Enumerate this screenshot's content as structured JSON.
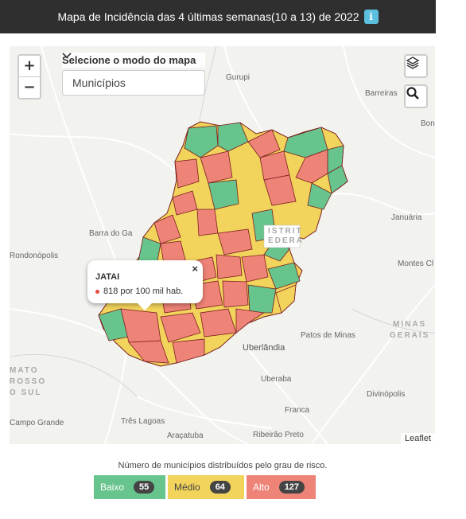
{
  "header": {
    "title": "Mapa de Incidência das 4 últimas semanas(10 a 13) de 2022",
    "info_icon": "info-icon"
  },
  "map_controls": {
    "zoom_in": "+",
    "zoom_out": "−",
    "mode_label": "Selecione o modo do mapa",
    "mode_selected": "Municípios",
    "layers_icon": "layers-icon",
    "search_icon": "search-icon"
  },
  "map_labels": {
    "gurupi": "Gurupi",
    "barreiras": "Barreiras",
    "bon": "Bon",
    "ob": "(",
    "barra": "Barra do Ga",
    "distrito1": "ISTRIT",
    "distrito2": "EDERA",
    "rondonopolis": "Rondonópolis",
    "montes": "Montes Cl",
    "januaria": "Januária",
    "patos": "Patos de Minas",
    "minas1": "MINAS",
    "minas2": "GERAIS",
    "uberlandia": "Uberlândia",
    "uberaba": "Uberaba",
    "mato1": "MATO",
    "mato2": "ROSSO",
    "mato3": "O SUL",
    "divinopolis": "Divinópolis",
    "franca": "Franca",
    "campo": "Campo Grande",
    "tres": "Três Lagoas",
    "aracatuba": "Araçatuba",
    "ribeirao": "Ribeirão Preto",
    "attribution": "Leaflet"
  },
  "popup": {
    "name": "JATAI",
    "value": "818 por 100 mil hab.",
    "close": "×"
  },
  "legend": {
    "title": "Número de municípios distribuídos pelo grau de risco.",
    "items": [
      {
        "label": "Baixo",
        "count": "55",
        "color": "#66c48c"
      },
      {
        "label": "Médio",
        "count": "64",
        "color": "#f2d35b"
      },
      {
        "label": "Alto",
        "count": "127",
        "color": "#ee8377"
      }
    ]
  },
  "colors": {
    "low": "#66c48c",
    "medium": "#f2d35b",
    "high": "#ee8377",
    "border": "#7a1f1f"
  }
}
